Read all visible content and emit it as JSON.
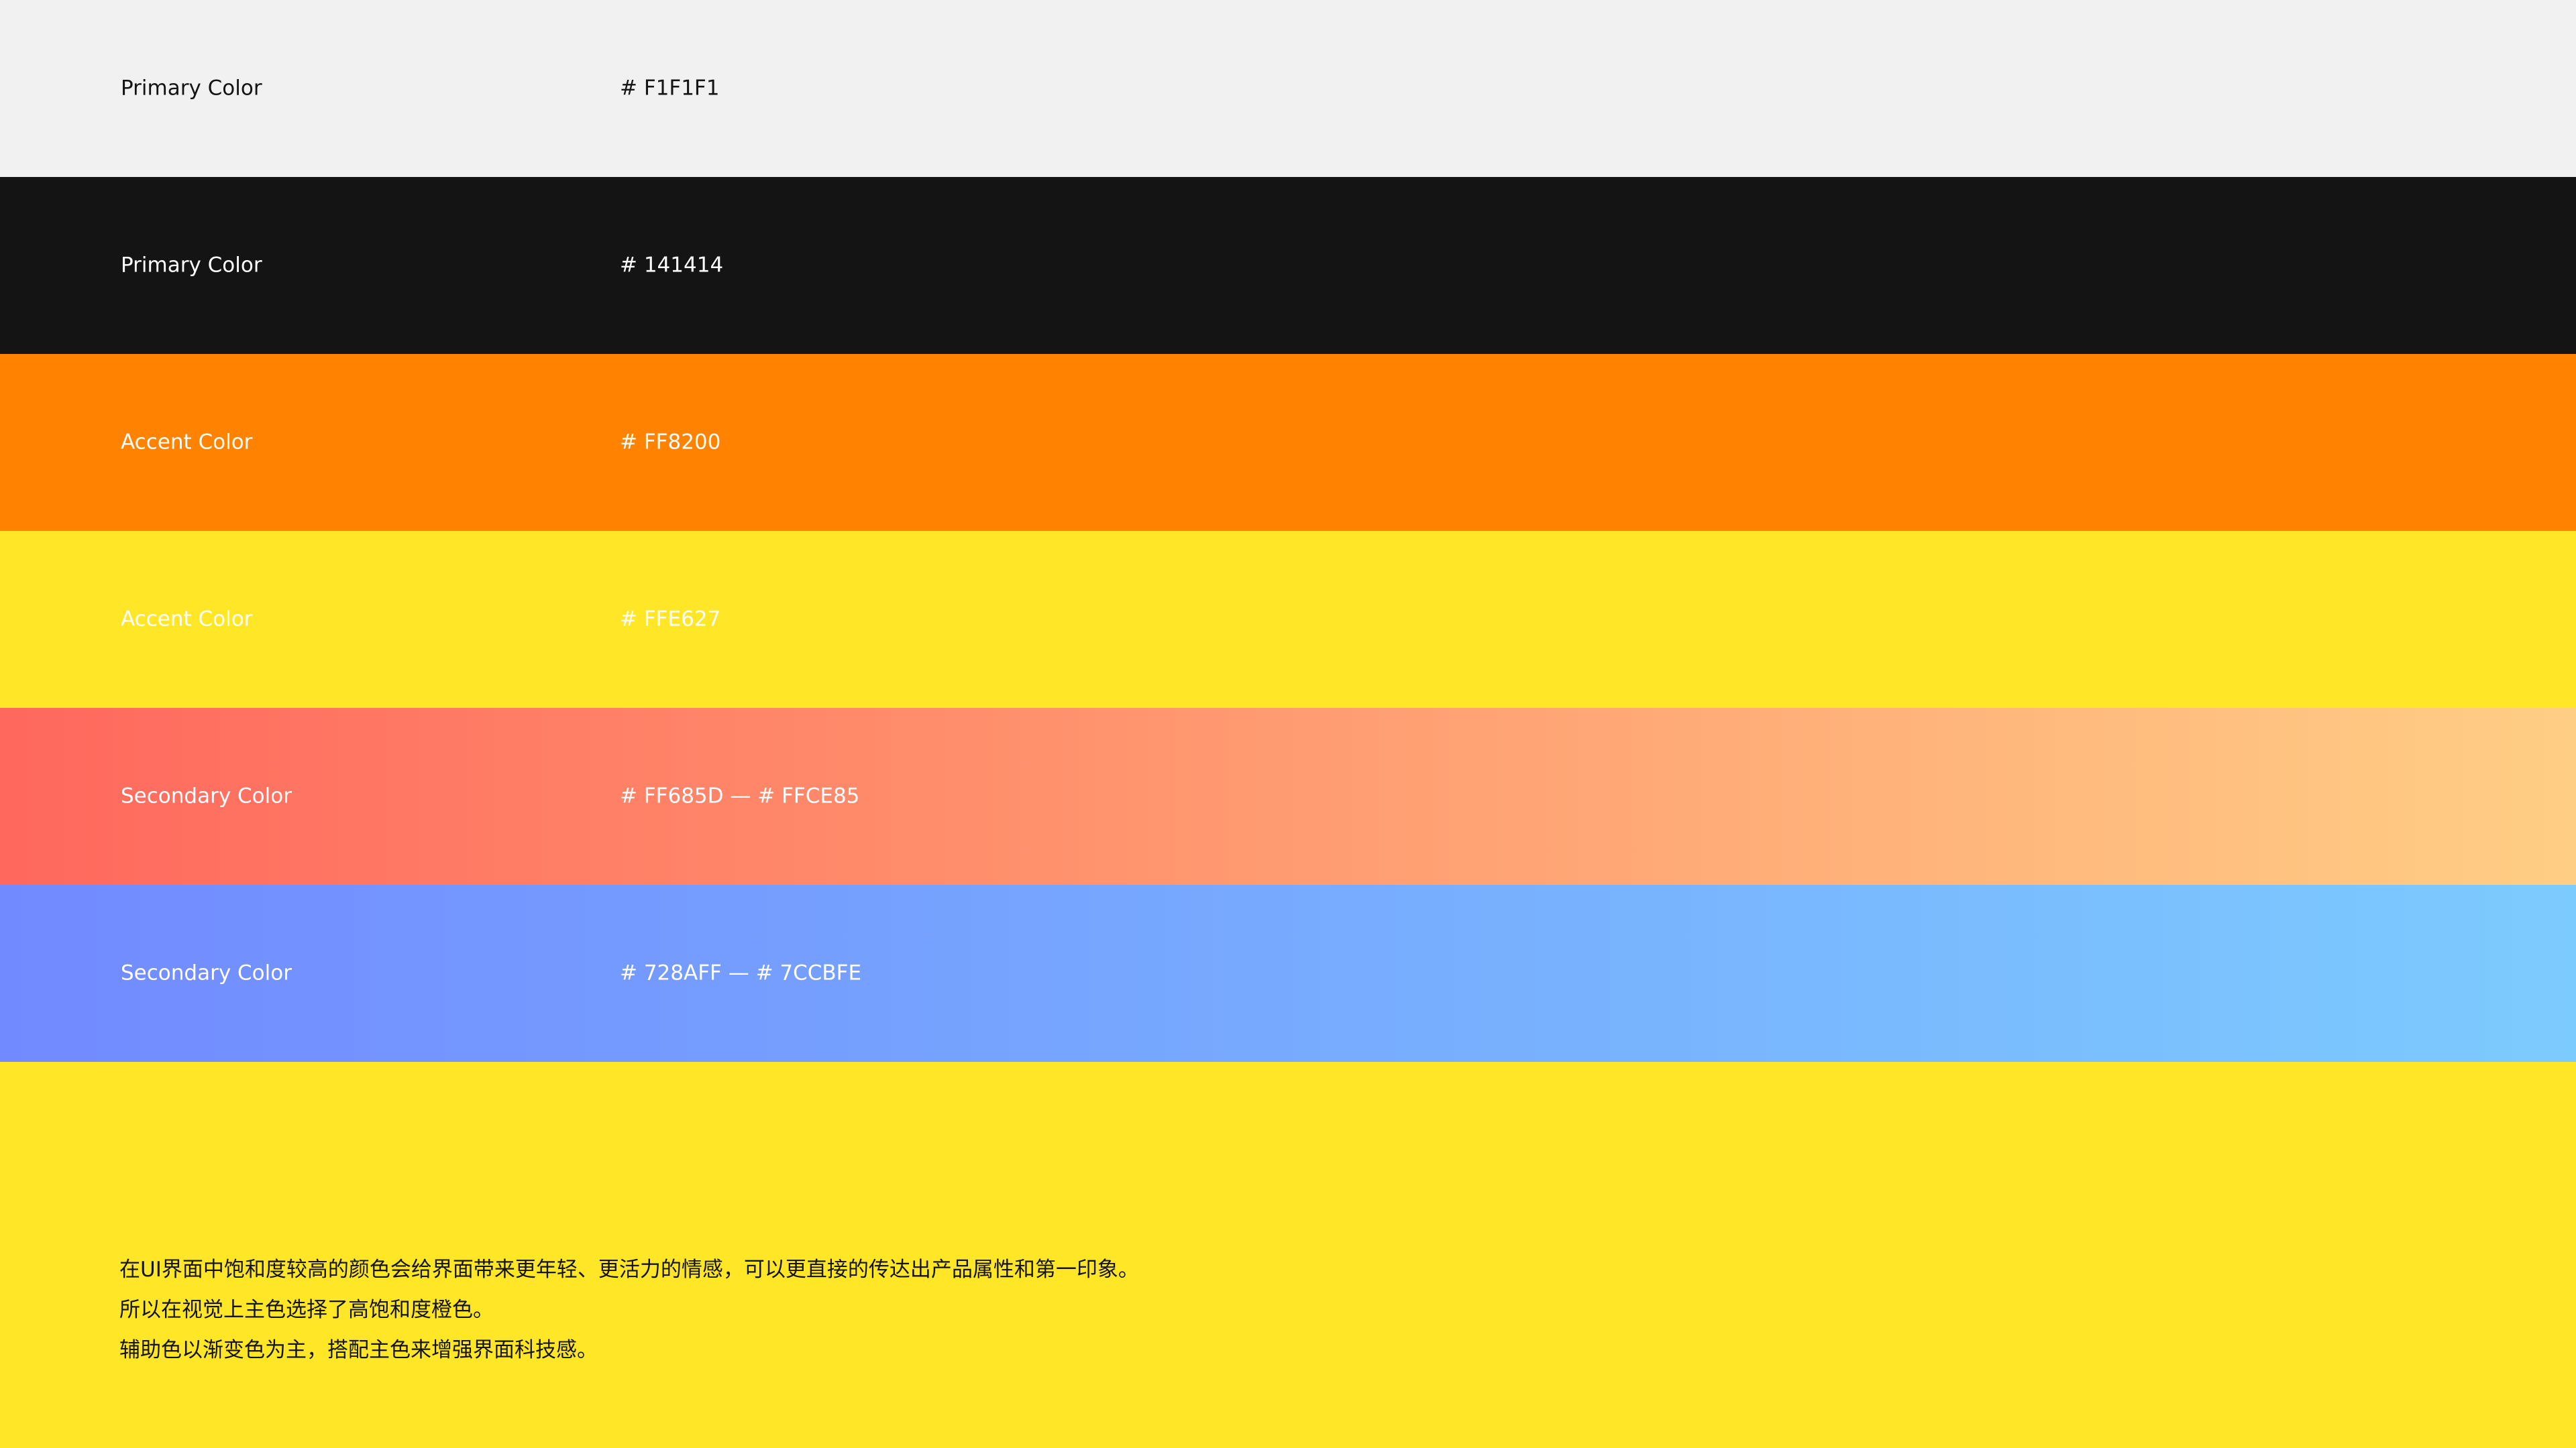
{
  "swatches": [
    {
      "label": "Primary Color",
      "hex": "# F1F1F1",
      "background": "#F1F1F1",
      "text_color": "#141414"
    },
    {
      "label": "Primary Color",
      "hex": "# 141414",
      "background": "#141414",
      "text_color": "#FFFFFF"
    },
    {
      "label": "Accent Color",
      "hex": "# FF8200",
      "background": "#FF8200",
      "text_color": "#FFFFFF"
    },
    {
      "label": "Accent Color",
      "hex": "# FFE627",
      "background": "#FFE627",
      "text_color": "#FFFFFF"
    },
    {
      "label": "Secondary Color",
      "hex": "# FF685D — # FFCE85",
      "gradient_from": "#FF685D",
      "gradient_to": "#FFCE85",
      "text_color": "#FFFFFF"
    },
    {
      "label": "Secondary Color",
      "hex": "# 728AFF — # 7CCBFE",
      "gradient_from": "#728AFF",
      "gradient_to": "#7CCBFE",
      "text_color": "#FFFFFF"
    }
  ],
  "description": {
    "lines": [
      "在UI界面中饱和度较高的颜色会给界面带来更年轻、更活力的情感，可以更直接的传达出产品属性和第一印象。",
      "所以在视觉上主色选择了高饱和度橙色。",
      "辅助色以渐变色为主，搭配主色来增强界面科技感。"
    ]
  },
  "page_background": "#FFE627"
}
